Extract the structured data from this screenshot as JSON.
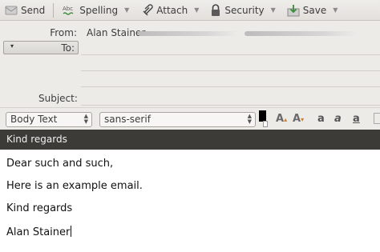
{
  "toolbar": {
    "send_label": "Send",
    "spelling_label": "Spelling",
    "attach_label": "Attach",
    "security_label": "Security",
    "save_label": "Save"
  },
  "header": {
    "from_label": "From:",
    "from_name": "Alan Stainer",
    "to_label": "To:",
    "subject_label": "Subject:"
  },
  "formatbar": {
    "paragraph_style": "Body Text",
    "font_family": "sans-serif"
  },
  "subject_value": "Kind regards",
  "body_lines": {
    "l1": "Dear such and such,",
    "l2": "Here is an example email.",
    "l3": "Kind regards",
    "l4": "Alan Stainer"
  },
  "colors": {
    "subject_bar": "#3c3b37",
    "chrome": "#edebe8"
  }
}
